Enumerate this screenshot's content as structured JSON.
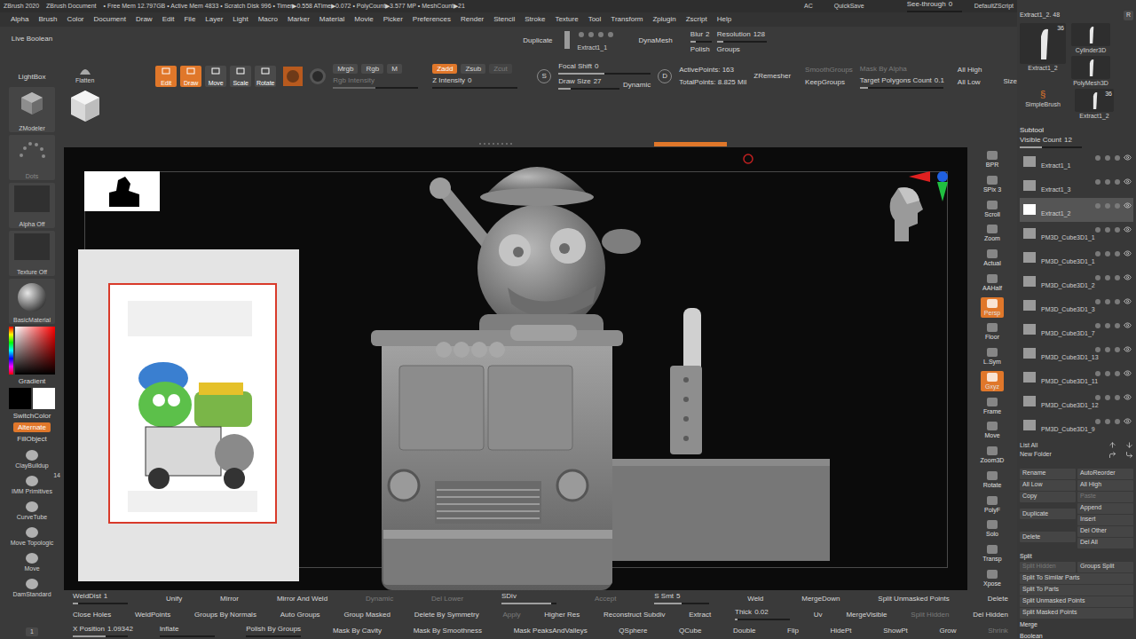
{
  "title_bar": {
    "app": "ZBrush 2020",
    "document": "ZBrush Document",
    "stats": "• Free Mem 12.797GB • Active Mem 4833 • Scratch Disk 996 • Timer▶0.558 ATime▶0.072 • PolyCount▶3.577 MP • MeshCount▶21",
    "ac": "AC",
    "quicksave": "QuickSave",
    "see_through": {
      "label": "See-through",
      "value": "0",
      "level": 0
    },
    "script": "DefaultZScript"
  },
  "menu": [
    "Alpha",
    "Brush",
    "Color",
    "Document",
    "Draw",
    "Edit",
    "File",
    "Layer",
    "Light",
    "Macro",
    "Marker",
    "Material",
    "Movie",
    "Picker",
    "Preferences",
    "Render",
    "Stencil",
    "Stroke",
    "Texture",
    "Tool",
    "Transform",
    "Zplugin",
    "Zscript",
    "Help"
  ],
  "left_shelf": {
    "live_boolean": "Live Boolean",
    "lightbox": "LightBox",
    "tiles": [
      "ZModeler",
      "Dots",
      "Alpha Off",
      "Texture Off",
      "BasicMaterial"
    ],
    "gradient": "Gradient",
    "switch_color": "SwitchColor",
    "alternate": {
      "label": "Alternate",
      "selected": true
    },
    "fill_object": "FillObject",
    "brushes": [
      {
        "label": "ClayBuildup"
      },
      {
        "label": "IMM Primitives",
        "count": "14"
      },
      {
        "label": "CurveTube"
      },
      {
        "label": "Move Topologic"
      },
      {
        "label": "Move"
      },
      {
        "label": "DamStandard"
      }
    ],
    "bottom_counter": "1"
  },
  "shelf": {
    "flatten": "Flatten",
    "modes": [
      {
        "label": "Edit",
        "selected": true
      },
      {
        "label": "Draw",
        "selected": true
      },
      {
        "label": "Move",
        "selected": false
      },
      {
        "label": "Scale",
        "selected": false
      },
      {
        "label": "Rotate",
        "selected": false
      }
    ],
    "color_modes": [
      {
        "label": "Mrgb",
        "selected": false
      },
      {
        "label": "Rgb",
        "selected": false
      },
      {
        "label": "M",
        "selected": false
      }
    ],
    "rgb_intensity": {
      "label": "Rgb Intensity",
      "disabled": true,
      "level": 0.5
    },
    "z_modes": [
      {
        "label": "Zadd",
        "selected": true,
        "disabled": false
      },
      {
        "label": "Zsub",
        "selected": false,
        "disabled": false
      },
      {
        "label": "Zcut",
        "selected": false,
        "disabled": true
      }
    ],
    "z_intensity": {
      "label": "Z Intensity",
      "value": "0",
      "level": 0
    },
    "s_key": "S",
    "d_key": "D",
    "focal_shift": {
      "label": "Focal Shift",
      "value": "0",
      "level": 0.5
    },
    "draw_size": {
      "label": "Draw Size",
      "value": "27",
      "level": 0.2
    },
    "dynamic": "Dynamic",
    "active_points": "ActivePoints: 163",
    "total_points": "TotalPoints: 8.825 Mil",
    "duplicate": "Duplicate",
    "extract_name": "Extract1_1",
    "dynamesh": "DynaMesh",
    "blur": {
      "label": "Blur",
      "value": "2",
      "level": 0.25
    },
    "resolution": {
      "label": "Resolution",
      "value": "128",
      "level": 0.12
    },
    "polish": "Polish",
    "groups": "Groups",
    "zremesher": "ZRemesher",
    "smooth_groups": {
      "label": "SmoothGroups",
      "disabled": true
    },
    "keep_groups": "KeepGroups",
    "mask_by_alpha": {
      "label": "Mask By Alpha",
      "disabled": true
    },
    "target_polygons": {
      "label": "Target Polygons Count",
      "value": "0.1",
      "level": 0.1
    },
    "all_high": "All High",
    "all_low": "All Low",
    "size": "Size"
  },
  "nav": [
    {
      "label": "BPR",
      "selected": false
    },
    {
      "label": "SPix 3",
      "selected": false
    },
    {
      "label": "Scroll",
      "selected": false
    },
    {
      "label": "Zoom",
      "selected": false
    },
    {
      "label": "Actual",
      "selected": false
    },
    {
      "label": "AAHalf",
      "selected": false
    },
    {
      "label": "Persp",
      "selected": true
    },
    {
      "label": "Floor",
      "selected": false
    },
    {
      "label": "L.Sym",
      "selected": false
    },
    {
      "label": "Gxyz",
      "selected": true
    },
    {
      "label": "Frame",
      "selected": false
    },
    {
      "label": "Move",
      "selected": false
    },
    {
      "label": "Zoom3D",
      "selected": false
    },
    {
      "label": "Rotate",
      "selected": false
    },
    {
      "label": "PolyF",
      "selected": false
    },
    {
      "label": "Solo",
      "selected": false
    },
    {
      "label": "Transp",
      "selected": false
    },
    {
      "label": "Xpose",
      "selected": false
    }
  ],
  "tool_panel": {
    "name": "Extract1_2. 48",
    "r": "R",
    "tools": [
      {
        "label": "Extract1_2",
        "count": "36"
      },
      {
        "label": "Cylinder3D"
      },
      {
        "label": "PolyMesh3D"
      },
      {
        "label": "SimpleBrush"
      },
      {
        "label": "Extract1_2",
        "count": "36"
      }
    ]
  },
  "subtool": {
    "title": "Subtool",
    "visible_count": {
      "label": "Visible Count",
      "value": "12",
      "level": 0.35
    },
    "items": [
      {
        "name": "Extract1_1",
        "selected": false,
        "visible": true
      },
      {
        "name": "Extract1_3",
        "selected": false,
        "visible": true
      },
      {
        "name": "Extract1_2",
        "selected": true,
        "visible": true
      },
      {
        "name": "PM3D_Cube3D1_1",
        "selected": false,
        "visible": true
      },
      {
        "name": "PM3D_Cube3D1_1",
        "selected": false,
        "visible": true
      },
      {
        "name": "PM3D_Cube3D1_2",
        "selected": false,
        "visible": true
      },
      {
        "name": "PM3D_Cube3D1_3",
        "selected": false,
        "visible": true
      },
      {
        "name": "PM3D_Cube3D1_7",
        "selected": false,
        "visible": true
      },
      {
        "name": "PM3D_Cube3D1_13",
        "selected": false,
        "visible": true
      },
      {
        "name": "PM3D_Cube3D1_11",
        "selected": false,
        "visible": true
      },
      {
        "name": "PM3D_Cube3D1_12",
        "selected": false,
        "visible": true
      },
      {
        "name": "PM3D_Cube3D1_9",
        "selected": false,
        "visible": true
      }
    ],
    "list_all": "List All",
    "new_folder": "New Folder"
  },
  "subtool_actions": [
    {
      "left": [
        {
          "label": "Rename",
          "disabled": false
        }
      ],
      "right": [
        {
          "label": "AutoReorder",
          "disabled": false
        }
      ]
    },
    {
      "left": [
        {
          "label": "All Low",
          "disabled": false
        }
      ],
      "right": [
        {
          "label": "All High",
          "disabled": false
        }
      ]
    },
    {
      "left": [
        {
          "label": "Copy",
          "disabled": false
        }
      ],
      "right": [
        {
          "label": "Paste",
          "disabled": true
        }
      ]
    },
    {
      "left": [
        {
          "label": "Duplicate",
          "disabled": false
        }
      ],
      "right": [
        {
          "label": "Append",
          "disabled": false
        },
        {
          "label": "Insert",
          "disabled": false
        }
      ]
    },
    {
      "left": [
        {
          "label": "Delete",
          "disabled": false
        }
      ],
      "right": [
        {
          "label": "Del Other",
          "disabled": false
        },
        {
          "label": "Del All",
          "disabled": false
        }
      ]
    }
  ],
  "split": {
    "title": "Split",
    "rows": [
      [
        {
          "label": "Split Hidden",
          "disabled": true
        },
        {
          "label": "Groups Split",
          "disabled": false
        }
      ],
      [
        {
          "label": "Split To Similar Parts",
          "disabled": false
        }
      ],
      [
        {
          "label": "Split To Parts",
          "disabled": false
        }
      ],
      [
        {
          "label": "Split Unmasked Points",
          "disabled": false
        }
      ],
      [
        {
          "label": "Split Masked Points",
          "disabled": false
        }
      ]
    ],
    "headers": [
      "Merge",
      "Boolean"
    ]
  },
  "bottom_shelf": [
    [
      {
        "kind": "slider",
        "label": "WeldDist",
        "value": "1",
        "level": 0.1
      },
      {
        "kind": "button",
        "label": "Unify",
        "disabled": false
      },
      {
        "kind": "button",
        "label": "Mirror",
        "disabled": false
      },
      {
        "kind": "button",
        "label": "Mirror And Weld",
        "disabled": false
      },
      {
        "kind": "button",
        "label": "Dynamic",
        "disabled": true
      },
      {
        "kind": "button",
        "label": "Del Lower",
        "disabled": true
      },
      {
        "kind": "slider",
        "label": "SDiv",
        "level": 0.9
      },
      {
        "kind": "button",
        "label": "Accept",
        "disabled": true
      },
      {
        "kind": "slider",
        "label": "S Smt",
        "value": "5",
        "level": 0.5
      },
      {
        "kind": "button",
        "label": "Weld",
        "disabled": false
      },
      {
        "kind": "button",
        "label": "MergeDown",
        "disabled": false
      },
      {
        "kind": "button",
        "label": "Split Unmasked Points",
        "disabled": false
      },
      {
        "kind": "button",
        "label": "Delete",
        "disabled": false
      }
    ],
    [
      {
        "kind": "button",
        "label": "Close Holes",
        "disabled": false
      },
      {
        "kind": "button",
        "label": "WeldPoints",
        "disabled": false
      },
      {
        "kind": "button",
        "label": "Groups By Normals",
        "disabled": false
      },
      {
        "kind": "button",
        "label": "Auto Groups",
        "disabled": false
      },
      {
        "kind": "button",
        "label": "Group Masked",
        "disabled": false
      },
      {
        "kind": "button",
        "label": "Delete By Symmetry",
        "disabled": false
      },
      {
        "kind": "button",
        "label": "Apply",
        "disabled": true
      },
      {
        "kind": "button",
        "label": "Higher Res",
        "disabled": false
      },
      {
        "kind": "button",
        "label": "Reconstruct Subdiv",
        "disabled": false
      },
      {
        "kind": "button",
        "label": "Extract",
        "disabled": false
      },
      {
        "kind": "slider",
        "label": "Thick",
        "value": "0.02",
        "level": 0.05
      },
      {
        "kind": "button",
        "label": "Uv",
        "disabled": false
      },
      {
        "kind": "button",
        "label": "MergeVisible",
        "disabled": false
      },
      {
        "kind": "button",
        "label": "Split Hidden",
        "disabled": true
      },
      {
        "kind": "button",
        "label": "Del Hidden",
        "disabled": false
      }
    ],
    [
      {
        "kind": "slider",
        "label": "X Position",
        "value": "1.09342",
        "level": 0.6
      },
      {
        "kind": "slider",
        "label": "Inflate",
        "level": 0
      },
      {
        "kind": "slider",
        "label": "Polish By Groups",
        "level": 0
      },
      {
        "kind": "button",
        "label": "Mask By Cavity",
        "disabled": false
      },
      {
        "kind": "button",
        "label": "Mask By Smoothness",
        "disabled": false
      },
      {
        "kind": "button",
        "label": "Mask PeaksAndValleys",
        "disabled": false
      },
      {
        "kind": "button",
        "label": "QSphere",
        "disabled": false
      },
      {
        "kind": "button",
        "label": "QCube",
        "disabled": false
      },
      {
        "kind": "button",
        "label": "Double",
        "disabled": false
      },
      {
        "kind": "button",
        "label": "Flip",
        "disabled": false
      },
      {
        "kind": "button",
        "label": "HidePt",
        "disabled": false
      },
      {
        "kind": "button",
        "label": "ShowPt",
        "disabled": false
      },
      {
        "kind": "button",
        "label": "Grow",
        "disabled": false
      },
      {
        "kind": "button",
        "label": "Shrink",
        "disabled": true
      }
    ]
  ]
}
